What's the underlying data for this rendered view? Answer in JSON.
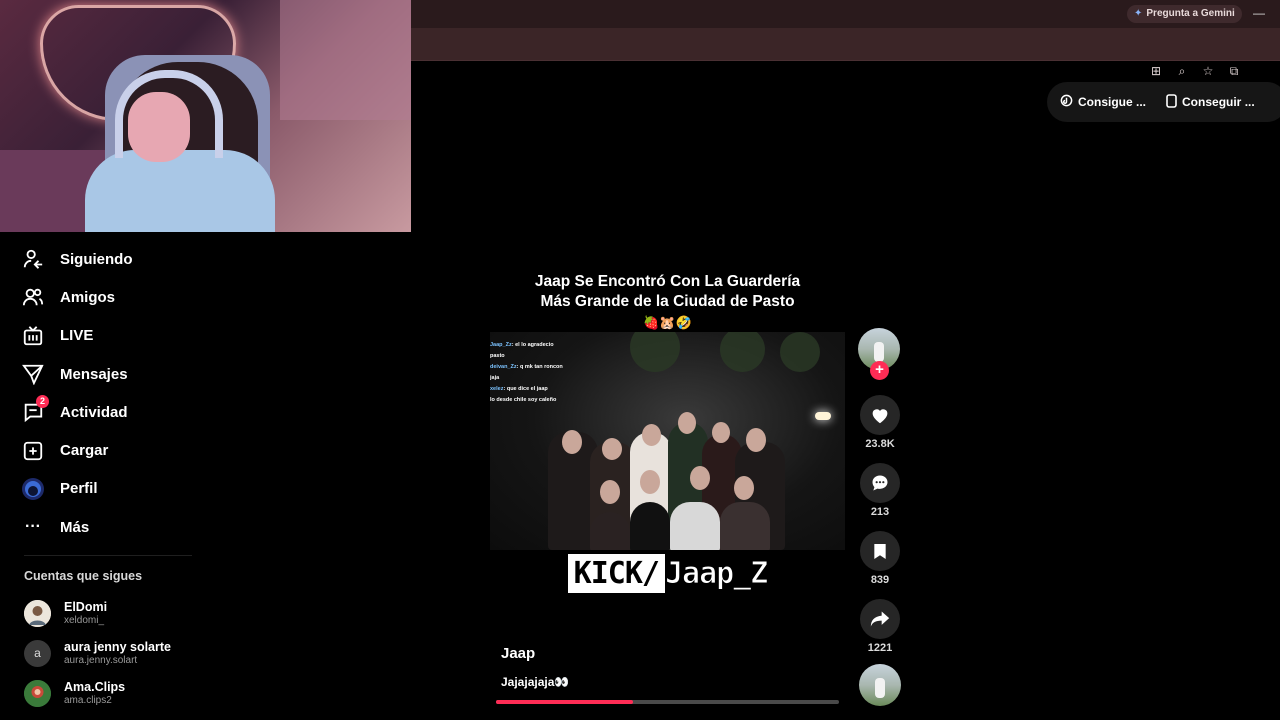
{
  "browser": {
    "gemini_button": "Pregunta a Gemini"
  },
  "sidebar": {
    "items": [
      {
        "label": "Siguiendo",
        "icon": "following-icon"
      },
      {
        "label": "Amigos",
        "icon": "friends-icon"
      },
      {
        "label": "LIVE",
        "icon": "live-icon"
      },
      {
        "label": "Mensajes",
        "icon": "messages-icon"
      },
      {
        "label": "Actividad",
        "icon": "activity-icon",
        "badge": "2"
      },
      {
        "label": "Cargar",
        "icon": "upload-icon"
      },
      {
        "label": "Perfil",
        "icon": "profile-avatar"
      },
      {
        "label": "Más",
        "icon": "more-icon"
      }
    ],
    "following_title": "Cuentas que sigues",
    "accounts": [
      {
        "name": "ElDomi",
        "handle": "xeldomi_"
      },
      {
        "name": "aura jenny solarte",
        "handle": "aura.jenny.solart",
        "initial": "a"
      },
      {
        "name": "Ama.Clips",
        "handle": "ama.clips2"
      }
    ]
  },
  "top_actions": {
    "coins": "Consigue ...",
    "app": "Conseguir ..."
  },
  "video": {
    "title_line1": "Jaap Se Encontró Con La Guardería",
    "title_line2": "Más Grande de la Ciudad de Pasto",
    "title_emoji": "🍓🐹🤣",
    "chat": [
      {
        "user": "Jaap_Zz",
        "text": ": el lo agradecio"
      },
      {
        "user": "",
        "text": "pasto"
      },
      {
        "user": "deivan_Zz",
        "text": ": q mk tan roncon"
      },
      {
        "user": "",
        "text": "jaja"
      },
      {
        "user": "xelez",
        "text": ": que dice el jaap"
      },
      {
        "user": "",
        "text": "lo desde chile soy caleño"
      }
    ],
    "overlay_kick": "KICK/",
    "overlay_name": "Jaap_Z",
    "author": "Jaap",
    "description": "Jajajajaja👀",
    "progress": 0.4
  },
  "actions": {
    "likes": "23.8K",
    "comments": "213",
    "saves": "839",
    "shares": "1221"
  }
}
